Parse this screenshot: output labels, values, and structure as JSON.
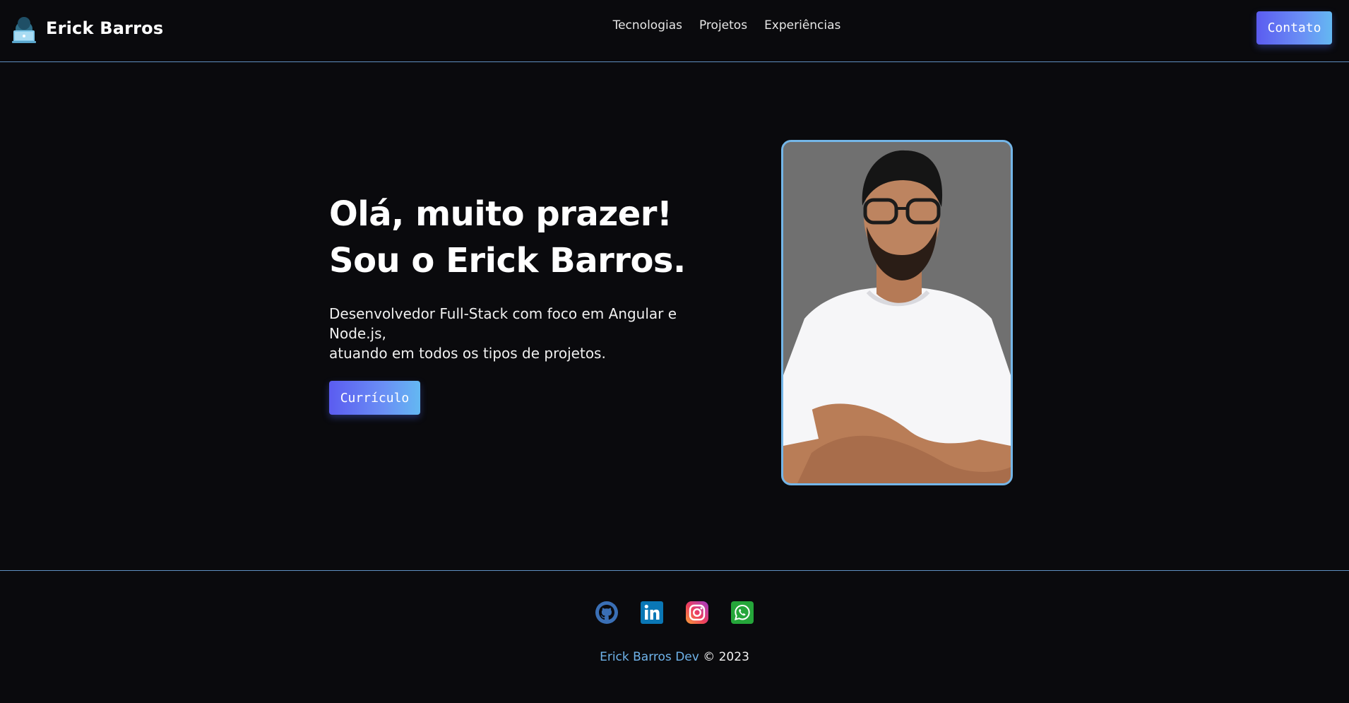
{
  "header": {
    "brand_name": "Erick Barros",
    "logo_icon": "developer-avatar-icon",
    "nav": [
      {
        "label": "Tecnologias"
      },
      {
        "label": "Projetos"
      },
      {
        "label": "Experiências"
      }
    ],
    "contact_label": "Contato"
  },
  "hero": {
    "heading_line1": "Olá, muito prazer!",
    "heading_line2": "Sou o Erick Barros.",
    "description_line1": "Desenvolvedor Full-Stack com foco em Angular e Node.js,",
    "description_line2": "atuando em todos os tipos de projetos.",
    "cv_label": "Currículo",
    "photo_alt": "Erick Barros"
  },
  "footer": {
    "social": [
      {
        "icon": "github-icon"
      },
      {
        "icon": "linkedin-icon"
      },
      {
        "icon": "instagram-icon"
      },
      {
        "icon": "whatsapp-icon"
      }
    ],
    "copyright_link": "Erick Barros Dev",
    "copyright_text": " © 2023"
  },
  "colors": {
    "background": "#0a0a0d",
    "divider": "#5f8fc0",
    "accent_gradient_start": "#5b5cf0",
    "accent_gradient_end": "#64b8f2",
    "link": "#6fb3ea",
    "photo_border": "#74b6e8"
  }
}
